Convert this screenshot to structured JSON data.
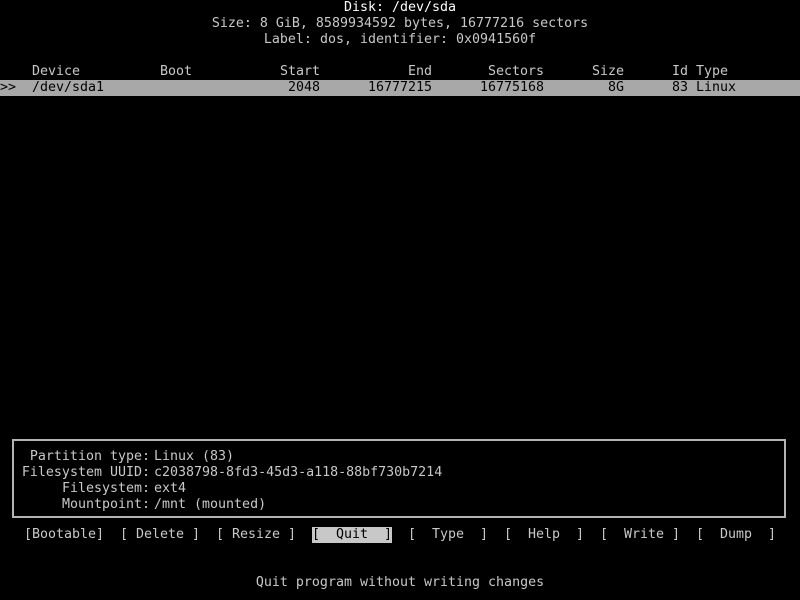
{
  "header": {
    "disk_line": "Disk: /dev/sda",
    "size_line": "Size: 8 GiB, 8589934592 bytes, 16777216 sectors",
    "label_line": "Label: dos, identifier: 0x0941560f"
  },
  "table": {
    "columns": {
      "device": "Device",
      "boot": "Boot",
      "start": "Start",
      "end": "End",
      "sectors": "Sectors",
      "size": "Size",
      "id": "Id",
      "type": "Type"
    },
    "rows": [
      {
        "cursor": ">>",
        "device": "/dev/sda1",
        "boot": "",
        "start": "2048",
        "end": "16777215",
        "sectors": "16775168",
        "size": "8G",
        "id": "83",
        "type": "Linux"
      }
    ]
  },
  "details": {
    "partition_type_label": "Partition type:",
    "partition_type_value": "Linux (83)",
    "fs_uuid_label": "Filesystem UUID:",
    "fs_uuid_value": "c2038798-8fd3-45d3-a118-88bf730b7214",
    "filesystem_label": "Filesystem:",
    "filesystem_value": "ext4",
    "mountpoint_label": "Mountpoint:",
    "mountpoint_value": "/mnt (mounted)"
  },
  "menu": {
    "bootable": "[Bootable]",
    "delete": "[ Delete ]",
    "resize": "[ Resize ]",
    "quit": "[  Quit  ]",
    "type": "[  Type  ]",
    "help": "[  Help  ]",
    "write": "[  Write ]",
    "dump": "[  Dump  ]",
    "selected": "quit"
  },
  "status": {
    "hint": "Quit program without writing changes"
  },
  "colors": {
    "background": "#000000",
    "text": "#c8c8c8",
    "highlight_row": "#a8a8a8",
    "active_button": "#c8c8c8"
  }
}
